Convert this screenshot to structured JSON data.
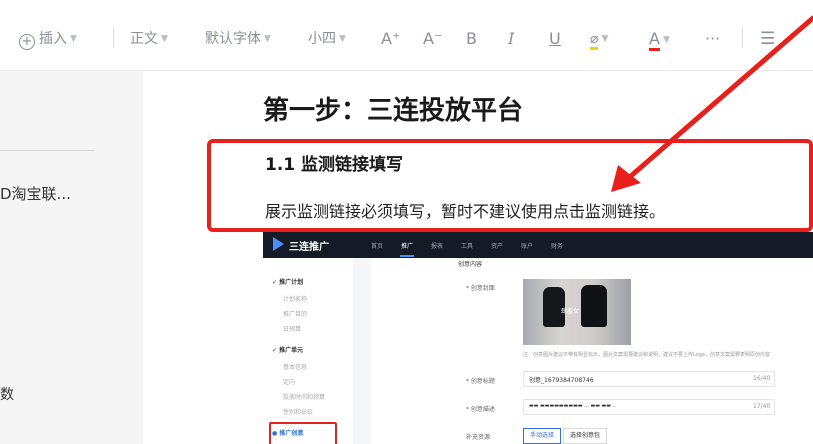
{
  "toolbar": {
    "insert": "插入",
    "style": "正文",
    "font": "默认字体",
    "size": "小四",
    "grow_font": "A⁺",
    "shrink_font": "A⁻",
    "bold": "B",
    "italic": "I",
    "underline": "U",
    "highlight_glyph": "⌀",
    "font_color": "A",
    "more": "···",
    "list_glyph": "☰",
    "icons": [
      "plus-circle-icon",
      "caret-down-icon",
      "font-increase-icon",
      "font-decrease-icon",
      "bold-icon",
      "italic-icon",
      "underline-icon",
      "highlighter-icon",
      "font-color-icon",
      "more-icon",
      "bullet-list-icon"
    ],
    "colors": {
      "highlight": "#e8d800",
      "font_color": "#e8201b"
    }
  },
  "sidebar": {
    "item_truncated": "D淘宝联...",
    "item_partial": "数"
  },
  "document": {
    "heading": "第一步：三连投放平台",
    "subheading": "1.1 监测链接填写",
    "paragraph": "展示监测链接必须填写，暂时不建议使用点击监测链接。"
  },
  "annotation": {
    "box_color": "#e8201b",
    "arrow_color": "#e8201b"
  },
  "screenshot": {
    "brand": "三连推广",
    "nav": [
      "首页",
      "推广",
      "报表",
      "工具",
      "资产",
      "账户",
      "财务"
    ],
    "active_nav": "推广",
    "side": {
      "plan_header": "推广计划",
      "plan_items": [
        "计划名称",
        "推广目的",
        "日预算"
      ],
      "unit_header": "推广单元",
      "unit_items": [
        "基本信息",
        "定向",
        "投放时间和预算",
        "性别和出价"
      ],
      "creative_header": "推广创意"
    },
    "main": {
      "section_title": "创意内容",
      "cover_label": "* 创意封面",
      "image_caption": "肆羞女",
      "hint": "注：创意图片建议不带有明显标示，图片文案需要建议和说明，建议不要上传Logo，创意文案需要表明原创内容",
      "title_label": "* 创意标题",
      "title_value": "创意_1679384708746",
      "title_count": "16/40",
      "desc_label": "* 创意描述",
      "desc_value": "▬▬ ▬▬▬▬▬▬▬▬▬ ... ▬▬ ▬▬ ..",
      "desc_count": "17/40",
      "extra_label": "补充资源",
      "btn_primary": "手动选择",
      "btn_secondary": "选择创意包"
    }
  }
}
